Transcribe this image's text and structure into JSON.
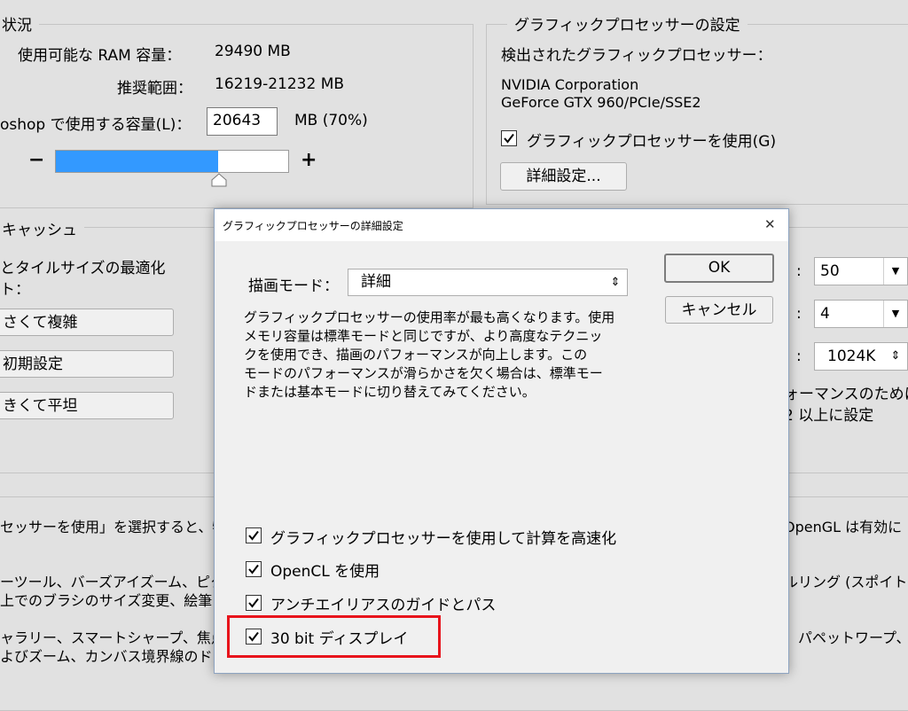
{
  "memory": {
    "legend": "状況",
    "available_label": "使用可能な RAM 容量：",
    "available_value": "29490 MB",
    "recommended_label": "推奨範囲：",
    "recommended_value": "16219-21232 MB",
    "use_label": "oshop で使用する容量(L)：",
    "use_value": "20643",
    "use_unit": "MB (70%)",
    "minus": "−",
    "plus": "+",
    "slider_fraction": 0.7
  },
  "gpu": {
    "legend": "グラフィックプロセッサーの設定",
    "detected_label": "検出されたグラフィックプロセッサー：",
    "vendor": "NVIDIA Corporation",
    "model": "GeForce GTX 960/PCIe/SSE2",
    "use_gpu_label": "グラフィックプロセッサーを使用(G)",
    "advanced_button": "詳細設定..."
  },
  "cache": {
    "legend": "キャッシュ",
    "tile_title": "とタイルサイズの最適化",
    "tile_sub": "ト：",
    "btn1": "さくて複雑",
    "btn2": "初期設定",
    "btn3": "きくて平坦",
    "history_value": "50",
    "levels_value": "4",
    "tile_value": "1024K",
    "perf_line1": "ォーマンスのために",
    "perf_line2": "2 以上に設定",
    "colon": ":"
  },
  "bottom_text": {
    "l1_left": "セッサーを使用」を選択すると、特",
    "l1_right": "OpenGL は有効に",
    "l2_left": "ーツール、バーズアイズーム、ピク",
    "l2_right": "ルリング (スポイト",
    "l3_left": "上でのブラシのサイズ変更、絵筆",
    "l4_left": "ャラリー、スマートシャープ、焦点領",
    "l4_right": "、パペットワープ、",
    "l5_left": "よびズーム、カンバス境界線のド"
  },
  "dialog": {
    "title": "グラフィックプロセッサーの詳細設定",
    "close": "✕",
    "mode_label": "描画モード：",
    "mode_value": "詳細",
    "ok": "OK",
    "cancel": "キャンセル",
    "desc1": "グラフィックプロセッサーの使用率が最も高くなります。使用",
    "desc2": "メモリ容量は標準モードと同じですが、より高度なテクニッ",
    "desc3": "クを使用でき、描画のパフォーマンスが向上します。この",
    "desc4": "モードのパフォーマンスが滑らかさを欠く場合は、標準モー",
    "desc5": "ドまたは基本モードに切り替えてみてください。",
    "options": [
      {
        "label": "グラフィックプロセッサーを使用して計算を高速化",
        "checked": true
      },
      {
        "label": "OpenCL を使用",
        "checked": true
      },
      {
        "label": "アンチエイリアスのガイドとパス",
        "checked": true
      },
      {
        "label": "30 bit ディスプレイ",
        "checked": true
      }
    ]
  },
  "colors": {
    "highlight": "#e8141c",
    "slider_fill": "#3399ff"
  }
}
